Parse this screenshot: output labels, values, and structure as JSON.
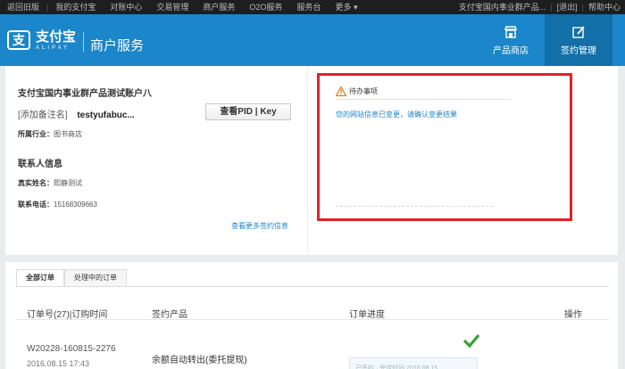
{
  "topbar": {
    "back_home": "返回旧版",
    "my_alipay": "我的支付宝",
    "reconcile": "对账中心",
    "trade_mgmt": "交易管理",
    "merchant_service": "商户服务",
    "o2o_service": "O2O服务",
    "service_desk": "服务台",
    "more": "更多",
    "account_name": "支付宝国内事业群产品...",
    "logout": "[退出]",
    "help": "帮助中心"
  },
  "header": {
    "logo_cn": "支付宝",
    "logo_en": "ALIPAY",
    "service_title": "商户服务",
    "nav": [
      {
        "label": "产品商店"
      },
      {
        "label": "签约管理"
      }
    ]
  },
  "account": {
    "title": "支付宝国内事业群产品测试账户八",
    "note_label": "[添加备注名]",
    "user_id": "testyufabuc...",
    "pid_button": "查看PID | Key",
    "industry_label": "所属行业：",
    "industry_value": "图书商店",
    "contact_title": "联系人信息",
    "realname_label": "真实姓名：",
    "realname_value": "熙静测试",
    "phone_label": "联系电话：",
    "phone_value": "15168309663",
    "more_link": "查看更多签约信息"
  },
  "todo": {
    "title": "待办事项",
    "message": "您的网站信息已变更，请确认变更结果"
  },
  "orders": {
    "tabs": [
      {
        "label": "全部订单"
      },
      {
        "label": "处理中的订单"
      }
    ],
    "headers": {
      "order_col": "订单号(27)|订购时间",
      "product_col": "签约产品",
      "progress_col": "订单进度",
      "action_col": "操作"
    },
    "rows": [
      {
        "order_no": "W20228-160815-2276",
        "time": "2016.08.15 17:43",
        "product": "余额自动转出(委托提现)",
        "progress_text": "已签约 · 完成时间 2016.08.15"
      }
    ]
  },
  "colors": {
    "brand_blue": "#1b86c9",
    "highlight_red": "#e3202a",
    "success_green": "#3aa12e"
  }
}
